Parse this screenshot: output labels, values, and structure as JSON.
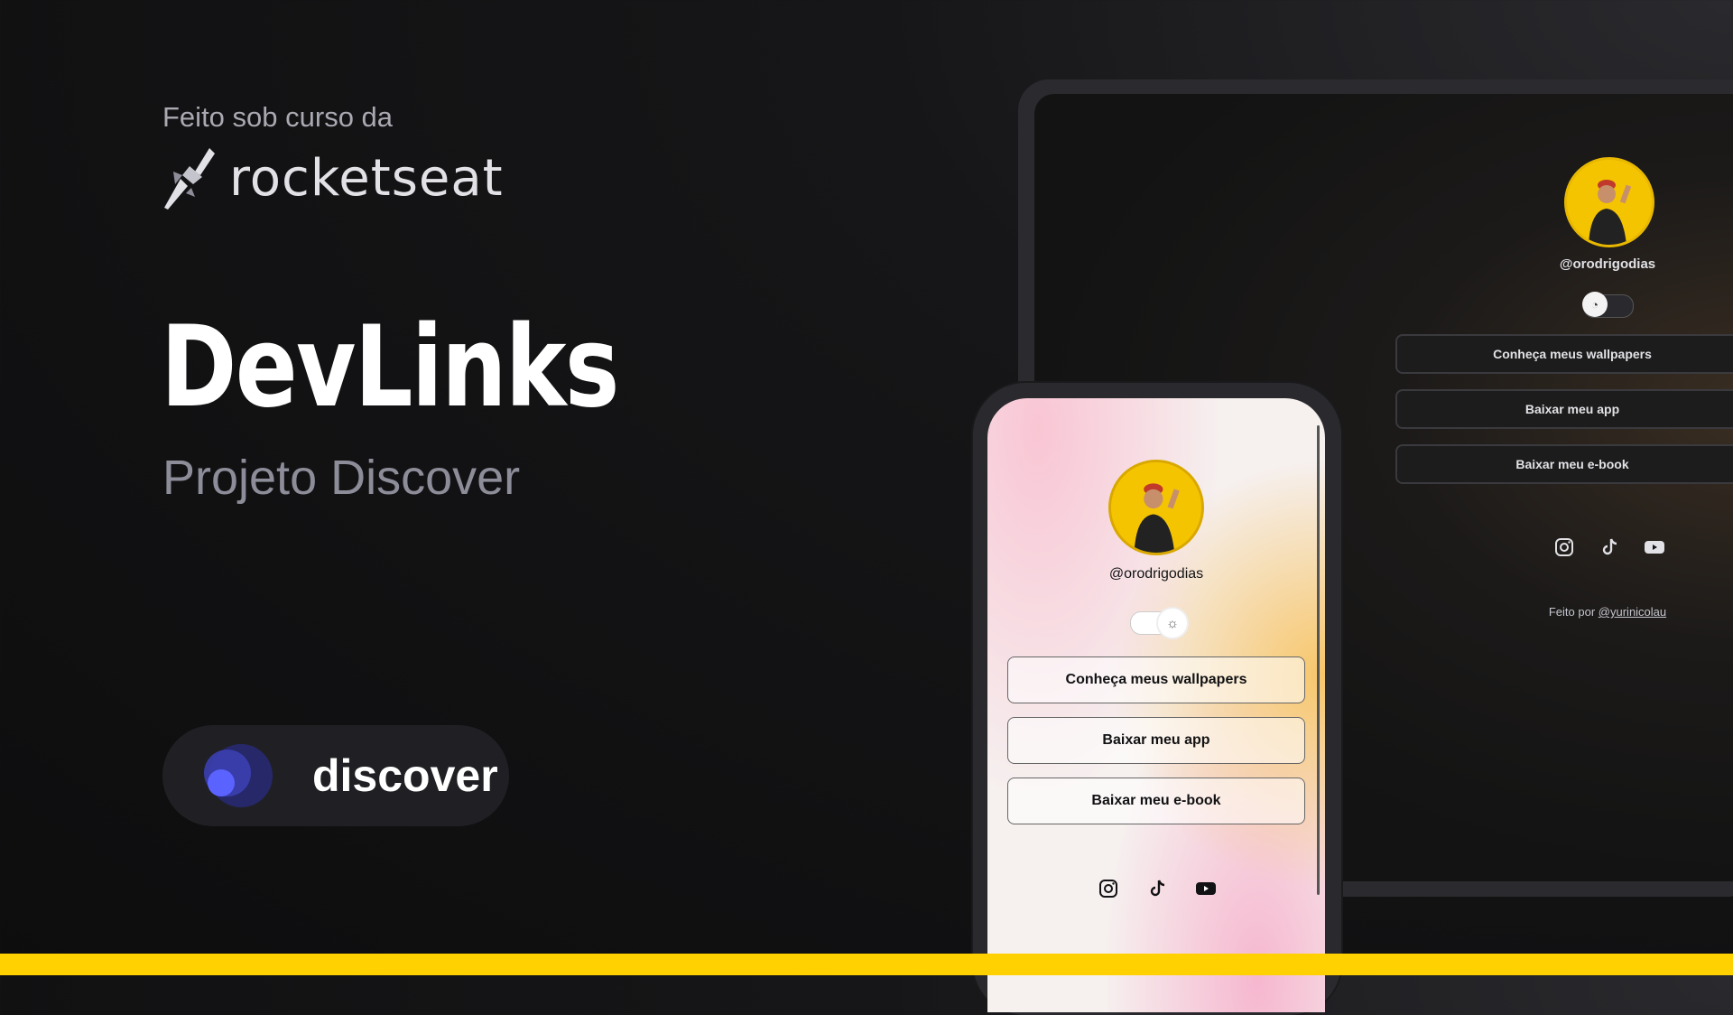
{
  "intro": {
    "made_under": "Feito sob curso da",
    "brand": "rocketseat"
  },
  "project": {
    "title": "DevLinks",
    "subtitle": "Projeto Discover"
  },
  "badge": {
    "label": "discover"
  },
  "profile": {
    "handle": "@orodrigodias",
    "links": [
      "Conheça meus wallpapers",
      "Baixar meu app",
      "Baixar meu e-book"
    ],
    "socials": [
      "instagram-icon",
      "tiktok-icon",
      "youtube-icon"
    ],
    "footer_prefix": "Feito por",
    "footer_user": "@yurinicolau"
  },
  "colors": {
    "accent": "#ffd100",
    "discover": "#5a63ff"
  }
}
